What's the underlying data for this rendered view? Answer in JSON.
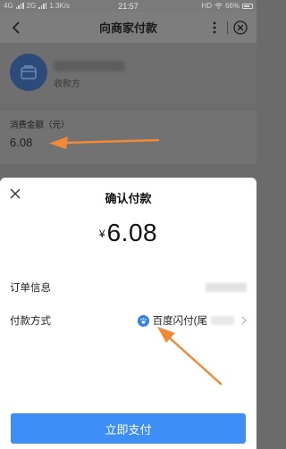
{
  "status_bar": {
    "network": "4G",
    "network2": "2G",
    "speed": "1.3K/s",
    "time": "21:57",
    "hd": "HD",
    "battery": "66%"
  },
  "header": {
    "title": "向商家付款",
    "back_icon": "chevron-left-icon",
    "more_icon": "more-vertical-icon",
    "close_icon": "close-circle-icon"
  },
  "merchant": {
    "role": "收款方"
  },
  "amount": {
    "label": "消费金额（元）",
    "value": "6.08"
  },
  "sheet": {
    "title": "确认付款",
    "currency": "¥",
    "amount": "6.08",
    "order_label": "订单信息",
    "method_label": "付款方式",
    "method_value": "百度闪付(尾",
    "pay_button": "立即支付"
  },
  "colors": {
    "accent": "#3e8ef7",
    "arrow": "#f08a3a",
    "avatar": "#2c4a7a"
  }
}
